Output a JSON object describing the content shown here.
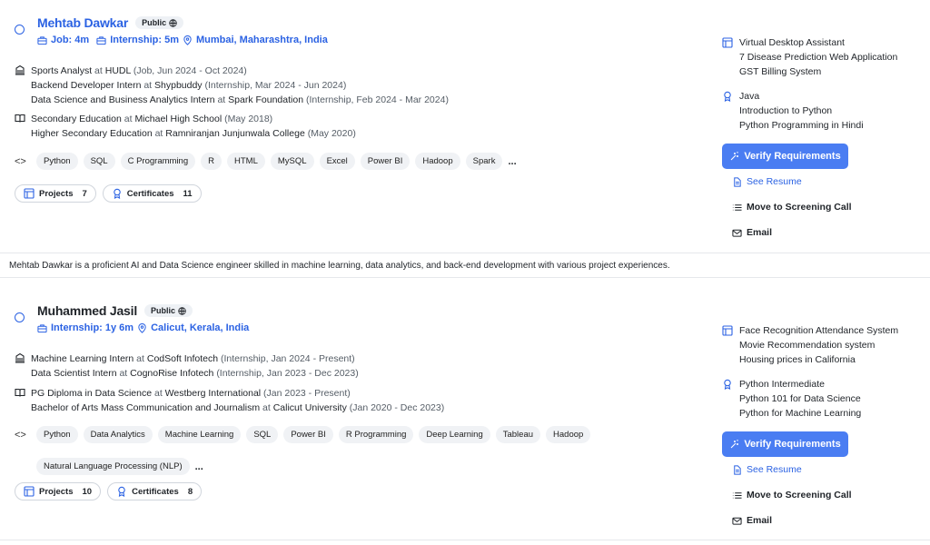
{
  "candidates": [
    {
      "name": "Mehtab Dawkar",
      "visibility": "Public",
      "meta": {
        "job": "Job: 4m",
        "internship": "Internship: 5m",
        "location": "Mumbai, Maharashtra, India"
      },
      "experience": [
        {
          "role": "Sports Analyst",
          "at": "at",
          "org": "HUDL",
          "detail": "(Job, Jun 2024 - Oct 2024)"
        },
        {
          "role": "Backend Developer Intern",
          "at": "at",
          "org": "Shypbuddy",
          "detail": "(Internship, Mar 2024 - Jun 2024)"
        },
        {
          "role": "Data Science and Business Analytics Intern",
          "at": "at",
          "org": "Spark Foundation",
          "detail": "(Internship, Feb 2024 - Mar 2024)"
        }
      ],
      "education": [
        {
          "role": "Secondary Education",
          "at": "at",
          "org": "Michael High School",
          "detail": "(May 2018)"
        },
        {
          "role": "Higher Secondary Education",
          "at": "at",
          "org": "Ramniranjan Junjunwala College",
          "detail": "(May 2020)"
        }
      ],
      "skills": [
        "Python",
        "SQL",
        "C Programming",
        "R",
        "HTML",
        "MySQL",
        "Excel",
        "Power BI",
        "Hadoop",
        "Spark"
      ],
      "projects_label": "Projects",
      "projects_count": "7",
      "certificates_label": "Certificates",
      "certificates_count": "11",
      "projects": [
        "Virtual Desktop Assistant",
        "7 Disease Prediction Web Application",
        "GST Billing System"
      ],
      "certificates": [
        "Java",
        "Introduction to Python",
        "Python Programming in Hindi"
      ],
      "summary": "Mehtab Dawkar is a proficient AI and Data Science engineer skilled in machine learning, data analytics, and back-end development with various project experiences."
    },
    {
      "name": "Muhammed Jasil",
      "visibility": "Public",
      "meta": {
        "internship": "Internship: 1y 6m",
        "location": "Calicut, Kerala, India"
      },
      "experience": [
        {
          "role": "Machine Learning Intern",
          "at": "at",
          "org": "CodSoft Infotech",
          "detail": "(Internship, Jan 2024 - Present)"
        },
        {
          "role": "Data Scientist Intern",
          "at": "at",
          "org": "CognoRise Infotech",
          "detail": "(Internship, Jan 2023 - Dec 2023)"
        }
      ],
      "education": [
        {
          "role": "PG Diploma in Data Science",
          "at": "at",
          "org": "Westberg International",
          "detail": "(Jan 2023 - Present)"
        },
        {
          "role": "Bachelor of Arts Mass Communication and Journalism",
          "at": "at",
          "org": "Calicut University",
          "detail": "(Jan 2020 - Dec 2023)"
        }
      ],
      "skills": [
        "Python",
        "Data Analytics",
        "Machine Learning",
        "SQL",
        "Power BI",
        "R Programming",
        "Deep Learning",
        "Tableau",
        "Hadoop",
        "Natural Language Processing (NLP)"
      ],
      "projects_label": "Projects",
      "projects_count": "10",
      "certificates_label": "Certificates",
      "certificates_count": "8",
      "projects": [
        "Face Recognition Attendance System",
        "Movie Recommendation system",
        "Housing prices in California"
      ],
      "certificates": [
        "Python Intermediate",
        "Python 101 for Data Science",
        "Python for Machine Learning"
      ]
    }
  ],
  "more": "...",
  "actions": {
    "verify": "Verify Requirements",
    "resume": "See Resume",
    "screening": "Move to Screening Call",
    "email": "Email"
  }
}
